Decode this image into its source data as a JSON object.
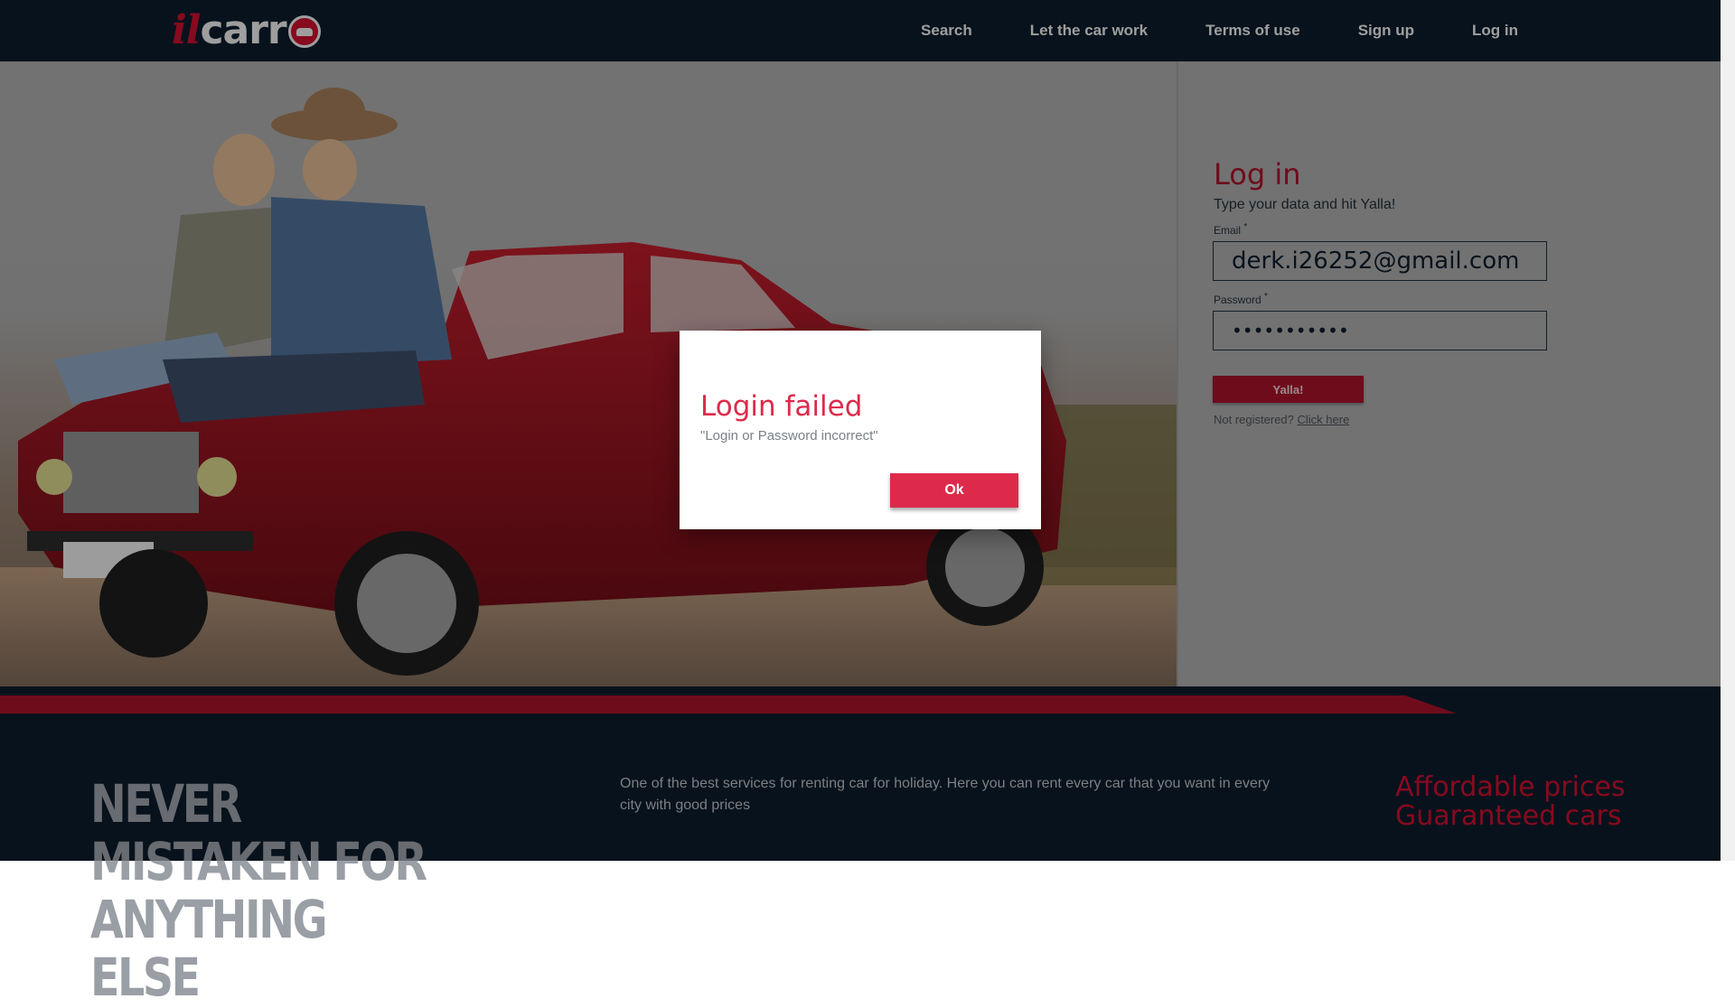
{
  "header": {
    "logo_prefix": "il",
    "logo_main": "carr",
    "nav": [
      {
        "label": "Search"
      },
      {
        "label": "Let the car work"
      },
      {
        "label": "Terms of use"
      },
      {
        "label": "Sign up"
      },
      {
        "label": "Log in"
      }
    ]
  },
  "login": {
    "title": "Log in",
    "subtitle": "Type your data and hit Yalla!",
    "email_label": "Email",
    "email_value": "derk.i26252@gmail.com",
    "password_label": "Password",
    "password_value": "•••••••••••",
    "required_mark": "*",
    "submit_label": "Yalla!",
    "not_registered": "Not registered?",
    "register_link": "Click here"
  },
  "footer": {
    "heading": "NEVER MISTAKEN FOR ANYTHING ELSE",
    "description": "One of the best services for renting car for holiday. Here you can rent every car that you want in every city with good prices",
    "feature_1": "Affordable prices",
    "feature_2": "Guaranteed cars"
  },
  "dialog": {
    "title": "Login failed",
    "message": "\"Login or Password incorrect\"",
    "ok_label": "Ok"
  },
  "colors": {
    "header_bg": "#0b1b2a",
    "brand_red": "#a3132a",
    "dialog_accent": "#dd2a4a"
  }
}
